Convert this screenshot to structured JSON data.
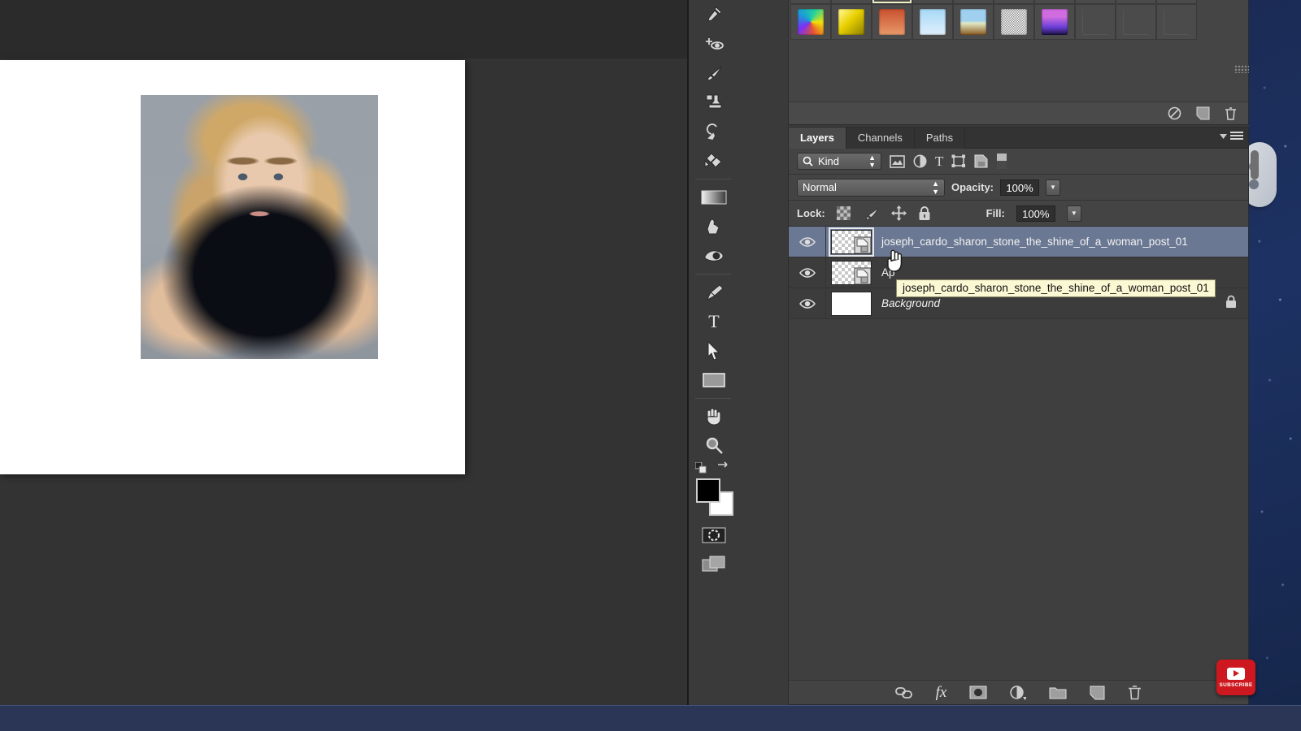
{
  "app": {
    "name": "Adobe Photoshop"
  },
  "canvas": {
    "document_background": "#ffffff",
    "workspace_background": "#333333",
    "photo_alt": "portrait-photo-blonde-woman-black-halter-top"
  },
  "tools": {
    "items": [
      {
        "name": "eyedropper-tool",
        "icon": "eyedropper-icon"
      },
      {
        "name": "spot-healing-brush-tool",
        "icon": "spot-healing-icon"
      },
      {
        "name": "brush-tool",
        "icon": "brush-icon"
      },
      {
        "name": "clone-stamp-tool",
        "icon": "stamp-icon"
      },
      {
        "name": "history-brush-tool",
        "icon": "history-brush-icon"
      },
      {
        "name": "eraser-tool",
        "icon": "eraser-icon"
      },
      {
        "name": "gradient-tool",
        "icon": "gradient-icon"
      },
      {
        "name": "blur-tool",
        "icon": "blur-finger-icon"
      },
      {
        "name": "dodge-tool",
        "icon": "dodge-hand-icon"
      },
      {
        "name": "pen-tool",
        "icon": "pen-icon"
      },
      {
        "name": "type-tool",
        "icon": "type-t-icon"
      },
      {
        "name": "path-selection-tool",
        "icon": "arrow-pointer-icon"
      },
      {
        "name": "rectangle-tool",
        "icon": "rectangle-shape-icon"
      },
      {
        "name": "hand-tool",
        "icon": "hand-icon"
      },
      {
        "name": "zoom-tool",
        "icon": "magnifier-icon"
      }
    ],
    "foreground_color": "#000000",
    "background_color": "#ffffff",
    "quick_mask_icon": "quick-mask-icon",
    "screen_mode_icon": "screen-mode-icon",
    "default_colors_icon": "default-colors-icon",
    "swap_colors_icon": "swap-colors-arrow-icon"
  },
  "styles_panel": {
    "selected_index": 2,
    "swatches": [
      {
        "name": "none-style",
        "css": "#ffffff"
      },
      {
        "name": "red-glow-style",
        "css": "radial-gradient(circle at 50% 45%, #ffd000 0 8%, #ff4400 40%, #8e0b00 100%)"
      },
      {
        "name": "outline-bevel-style",
        "css": "#4b4b4b"
      },
      {
        "name": "dark-chrome-spiral-style",
        "css": "radial-gradient(circle at 45% 40%, #e8e8e8 0 10%, #6d6d6d 35%, #151515 100%)"
      },
      {
        "name": "blue-glass-style",
        "css": "linear-gradient(135deg, #cfe9ff 0 20%, #2f8fe0 55%, #0e4f91 100%)"
      },
      {
        "name": "light-grey-style",
        "css": "linear-gradient(180deg,#d4d4d4,#b6b6b6)"
      },
      {
        "name": "grey-inner-bevel-style",
        "css": "radial-gradient(ellipse at 50% 120%, #f2f2f2 0 25%, #7d7d7d 60%, #3a3a3a 100%)"
      },
      {
        "name": "olive-gold-style",
        "css": "linear-gradient(180deg,#8e7526,#6d5a1b)"
      },
      {
        "name": "gold-style",
        "css": "linear-gradient(180deg,#b9952f,#8d7020)"
      },
      {
        "name": "red-stripes-style",
        "css": "repeating-linear-gradient(180deg,#e01030 0 4px,#f7c0c8 4px 6px,#c4072a 6px 10px)"
      },
      {
        "name": "rainbow-satin-style",
        "css": "conic-gradient(from 20deg, #22d3a0, #f2e205, #e8552f, #7b2ff7, #1b9bd8, #22d3a0)"
      },
      {
        "name": "yellow-bevel-style",
        "css": "linear-gradient(135deg,#fff27a 0 10%,#e8d000 45%,#8d7f00 100%)"
      },
      {
        "name": "sunset-gradient-style",
        "css": "linear-gradient(180deg,#c9502e,#e89a6a)"
      },
      {
        "name": "sky-blue-gradient-style",
        "css": "linear-gradient(180deg,#a7d8f5,#dfeffc)"
      },
      {
        "name": "landscape-gradient-style",
        "css": "linear-gradient(180deg,#9fd0ef 0 45%,#e2e8c2 55%,#8a5a22 100%)"
      },
      {
        "name": "noise-texture-style",
        "css": "repeating-conic-gradient(#ffffff 0 25%, #8d8d8d 0 50%) 0 0/3px 3px"
      },
      {
        "name": "purple-blue-style",
        "css": "linear-gradient(180deg,#d06ce0 0 30%,#6a3fd8 70%,#1c1040 100%)"
      },
      {
        "name": "empty-style-1",
        "css": "transparent"
      },
      {
        "name": "empty-style-2",
        "css": "transparent"
      },
      {
        "name": "empty-style-3",
        "css": "transparent"
      }
    ],
    "footer": {
      "clear_label": "clear-style-icon",
      "new_label": "new-style-icon",
      "delete_label": "delete-style-icon"
    }
  },
  "layers_panel": {
    "tabs": [
      {
        "label": "Layers",
        "active": true
      },
      {
        "label": "Channels",
        "active": false
      },
      {
        "label": "Paths",
        "active": false
      }
    ],
    "panel_menu_icon": "panel-menu-icon",
    "filter": {
      "kind_label": "Kind",
      "search_icon": "search-icon",
      "filters": [
        "filter-pixel-layers-icon",
        "filter-adjustment-layers-icon",
        "filter-type-layers-icon",
        "filter-shape-layers-icon",
        "filter-smart-object-icon",
        "filter-toggle-icon"
      ]
    },
    "blend": {
      "mode": "Normal",
      "opacity_label": "Opacity:",
      "opacity_value": "100%"
    },
    "lock": {
      "label": "Lock:",
      "icons": [
        "lock-transparent-pixels-icon",
        "lock-image-pixels-icon",
        "lock-position-icon",
        "lock-all-icon"
      ],
      "fill_label": "Fill:",
      "fill_value": "100%"
    },
    "layers": [
      {
        "name": "joseph_cardo_sharon_stone_the_shine_of_a_woman_post_01",
        "visible": true,
        "selected": true,
        "thumb_type": "transparent-smart-object",
        "italic": false,
        "locked": false
      },
      {
        "name": "Ap",
        "visible": true,
        "selected": false,
        "thumb_type": "transparent-smart-object",
        "italic": false,
        "locked": false
      },
      {
        "name": "Background",
        "visible": true,
        "selected": false,
        "thumb_type": "solid-white",
        "italic": true,
        "locked": true
      }
    ],
    "tooltip": {
      "text": "joseph_cardo_sharon_stone_the_shine_of_a_woman_post_01",
      "background": "#fbf8d4"
    },
    "footer_icons": [
      "link-layers-icon",
      "add-layer-style-icon",
      "add-layer-mask-icon",
      "new-adjustment-layer-icon",
      "new-group-icon",
      "new-layer-icon",
      "delete-layer-icon"
    ],
    "footer_fx_label": "fx",
    "selection_color": "#6b7893"
  },
  "overlay": {
    "subscribe_label": "SUBSCRIBE",
    "subscribe_color": "#cc181e"
  }
}
